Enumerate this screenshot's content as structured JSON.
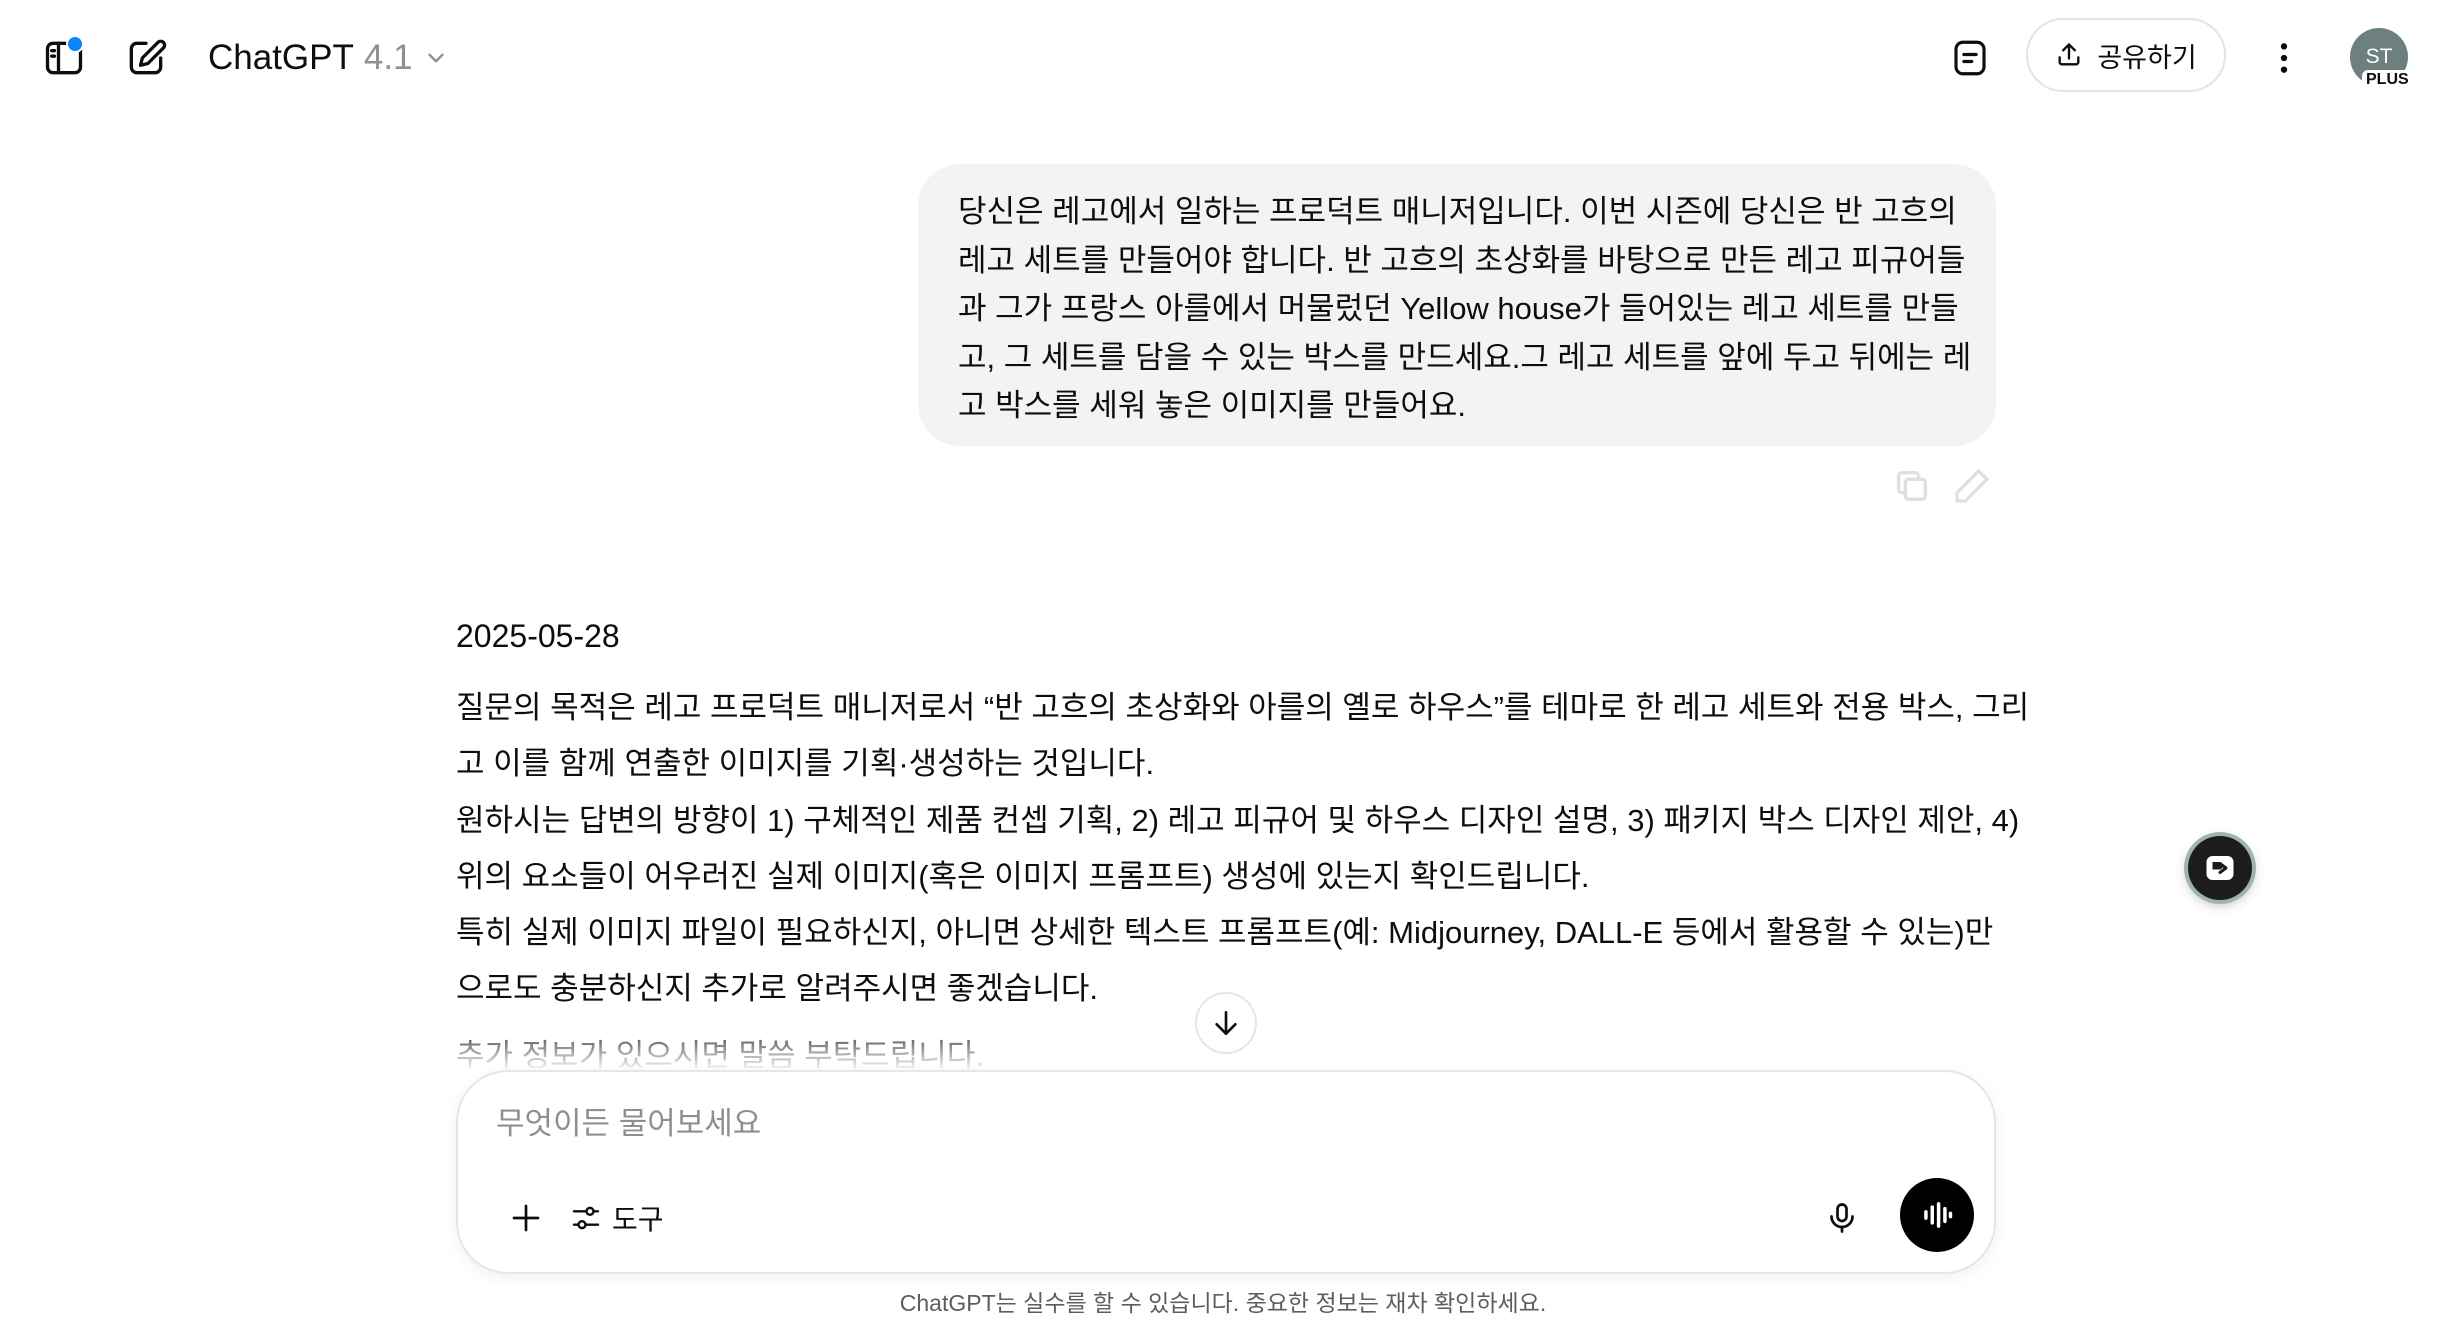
{
  "header": {
    "model_name": "ChatGPT",
    "model_version": "4.1",
    "share_label": "공유하기",
    "avatar_initials": "ST",
    "plan_badge": "PLUS",
    "notification_dot_color": "#0a84ff"
  },
  "user_message": {
    "lines": [
      "당신은 레고에서 일하는 프로덕트 매니저입니다. 이번 시즌에 당신은 반 고흐의",
      "레고 세트를 만들어야 합니다. 반 고흐의 초상화를 바탕으로 만든 레고 피규어들",
      "과 그가 프랑스 아를에서 머물렀던 Yellow house가 들어있는 레고 세트를 만들",
      "고, 그 세트를 담을 수 있는 박스를 만드세요.그 레고 세트를 앞에 두고 뒤에는 레",
      "고 박스를 세워 놓은 이미지를 만들어요."
    ]
  },
  "assistant_message": {
    "date": "2025-05-28",
    "lines": [
      "질문의 목적은 레고 프로덕트 매니저로서 “반 고흐의 초상화와 아를의 옐로 하우스”를 테마로 한 레고 세트와 전용 박스, 그리",
      "고 이를 함께 연출한 이미지를 기획·생성하는 것입니다.",
      "원하시는 답변의 방향이 1) 구체적인 제품 컨셉 기획, 2) 레고 피규어 및 하우스 디자인 설명, 3) 패키지 박스 디자인 제안, 4)",
      "위의 요소들이 어우러진 실제 이미지(혹은 이미지 프롬프트) 생성에 있는지 확인드립니다.",
      "특히 실제 이미지 파일이 필요하신지, 아니면 상세한 텍스트 프롬프트(예: Midjourney, DALL-E 등에서 활용할 수 있는)만",
      "으로도 충분하신지 추가로 알려주시면 좋겠습니다.",
      "추가 정보가 있으시면 말씀 부탁드립니다."
    ]
  },
  "composer": {
    "placeholder": "무엇이든 물어보세요",
    "tools_label": "도구"
  },
  "disclaimer": "ChatGPT는 실수를 할 수 있습니다. 중요한 정보는 재차 확인하세요.",
  "icons": {
    "sidebar_toggle": "sidebar-icon",
    "new_chat": "pencil-square-icon",
    "document": "document-icon",
    "share": "upload-icon",
    "more": "vertical-dots-icon",
    "copy": "copy-icon",
    "edit": "pencil-icon",
    "scroll_down": "arrow-down-icon",
    "add": "plus-icon",
    "tools": "sliders-icon",
    "mic": "microphone-icon",
    "voice": "waveform-icon",
    "floating": "extension-icon"
  }
}
